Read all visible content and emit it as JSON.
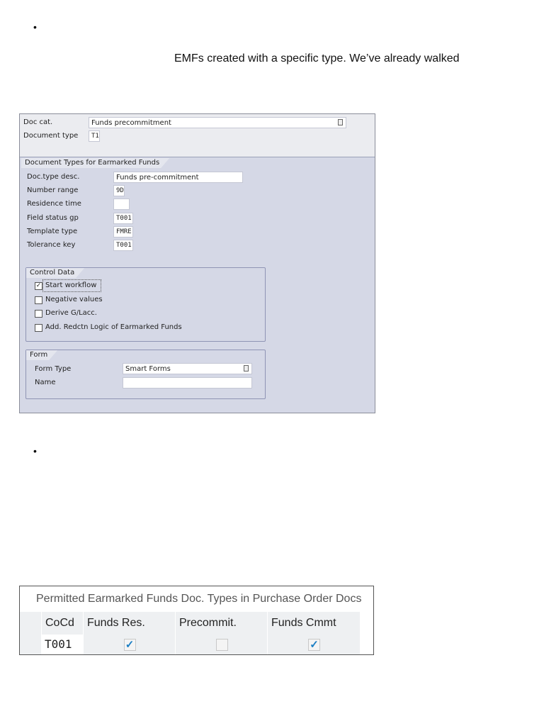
{
  "bullets": [
    "•",
    "•"
  ],
  "paragraph": "EMFs created with a specific type. We’ve already walked",
  "config_screen": {
    "doc_cat_label": "Doc cat.",
    "doc_cat_value": "Funds precommitment",
    "doc_type_label": "Document type",
    "doc_type_value": "T1",
    "section_title": "Document Types for Earmarked Funds",
    "fields": [
      {
        "label": "Doc.type desc.",
        "value": "Funds pre-commitment"
      },
      {
        "label": "Number range",
        "value": "9D"
      },
      {
        "label": "Residence time",
        "value": ""
      },
      {
        "label": "Field status gp",
        "value": "T001"
      },
      {
        "label": "Template type",
        "value": "FMRE"
      },
      {
        "label": "Tolerance key",
        "value": "T001"
      }
    ],
    "control_data": {
      "title": "Control Data",
      "items": [
        {
          "label": "Start workflow",
          "checked": true
        },
        {
          "label": "Negative values",
          "checked": false
        },
        {
          "label": "Derive G/Lacc.",
          "checked": false
        },
        {
          "label": "Add. Redctn Logic of Earmarked Funds",
          "checked": false
        }
      ]
    },
    "form": {
      "title": "Form",
      "form_type_label": "Form Type",
      "form_type_value": "Smart Forms",
      "name_label": "Name",
      "name_value": ""
    }
  },
  "table": {
    "title": "Permitted Earmarked Funds Doc. Types in Purchase Order Docs",
    "columns": [
      "CoCd",
      "Funds Res.",
      "Precommit.",
      "Funds Cmmt"
    ],
    "rows": [
      {
        "cocd": "T001",
        "funds_res": true,
        "precommit": false,
        "funds_cmmt": true
      }
    ]
  }
}
